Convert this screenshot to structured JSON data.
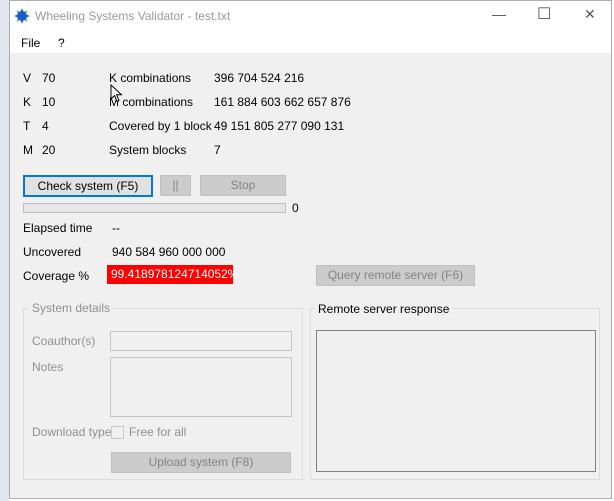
{
  "window": {
    "title": "Wheeling Systems Validator - test.txt",
    "minimize_glyph": "—",
    "maximize_glyph": "☐",
    "close_glyph": "✕"
  },
  "menu": {
    "file": "File",
    "help": "?"
  },
  "params": [
    {
      "key": "V",
      "value": "70"
    },
    {
      "key": "K",
      "value": "10"
    },
    {
      "key": "T",
      "value": "4"
    },
    {
      "key": "M",
      "value": "20"
    }
  ],
  "stats": [
    {
      "label": "K combinations",
      "value": "396 704 524 216"
    },
    {
      "label": "M combinations",
      "value": "161 884 603 662 657 876"
    },
    {
      "label": "Covered by 1 block",
      "value": "49 151 805 277 090 131"
    },
    {
      "label": "System blocks",
      "value": "7"
    }
  ],
  "buttons": {
    "check": "Check system (F5)",
    "pause": "||",
    "stop": "Stop",
    "query": "Query remote server (F6)",
    "upload": "Upload system (F8)"
  },
  "progress": {
    "value": 0,
    "label": "0"
  },
  "elapsed": {
    "label": "Elapsed time",
    "value": "--"
  },
  "uncovered": {
    "label": "Uncovered",
    "value": "940 584 960 000 000"
  },
  "coverage": {
    "label": "Coverage %",
    "value": "99.418978124714052%",
    "badge_color": "#ff0000"
  },
  "system_details": {
    "title": "System details",
    "coauthor_label": "Coauthor(s)",
    "notes_label": "Notes",
    "download_label": "Download type",
    "free_label": "Free for all"
  },
  "remote": {
    "title": "Remote server response"
  },
  "colors": {
    "accent": "#0078d7",
    "logo": "#1a5fc8"
  }
}
